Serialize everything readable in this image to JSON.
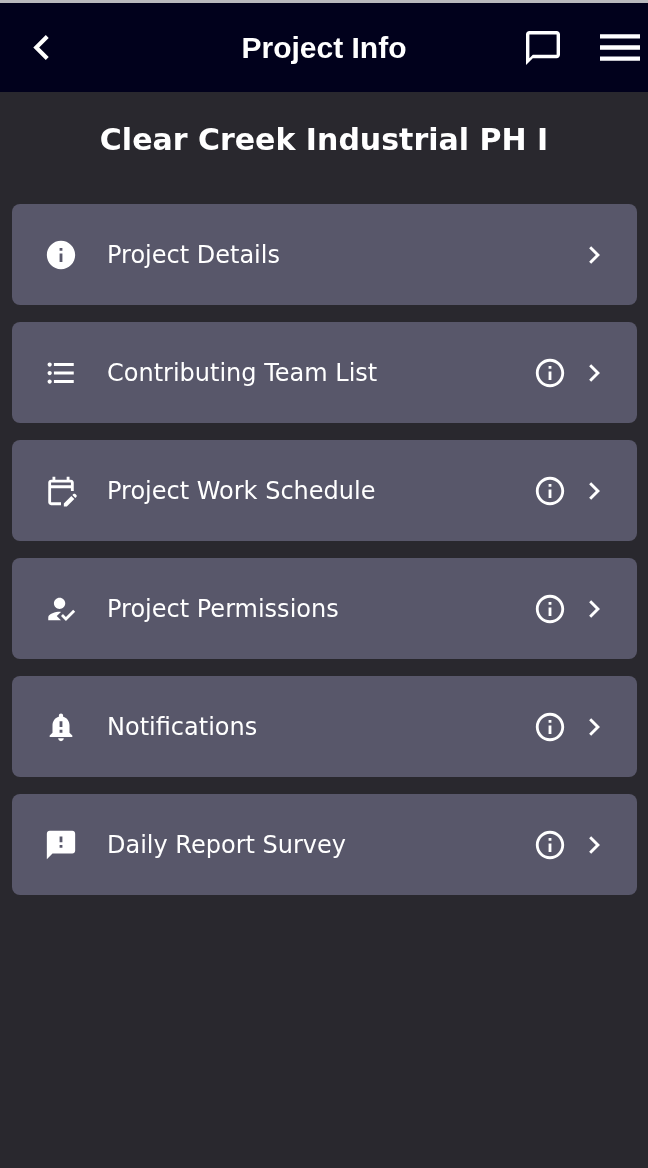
{
  "header": {
    "title": "Project Info"
  },
  "project_name": "Clear Creek Industrial PH I",
  "menu_items": [
    {
      "label": "Project Details",
      "info_button": false
    },
    {
      "label": "Contributing Team List",
      "info_button": true
    },
    {
      "label": "Project Work Schedule",
      "info_button": true
    },
    {
      "label": "Project Permissions",
      "info_button": true
    },
    {
      "label": "Notifications",
      "info_button": true
    },
    {
      "label": "Daily Report Survey",
      "info_button": true
    }
  ]
}
